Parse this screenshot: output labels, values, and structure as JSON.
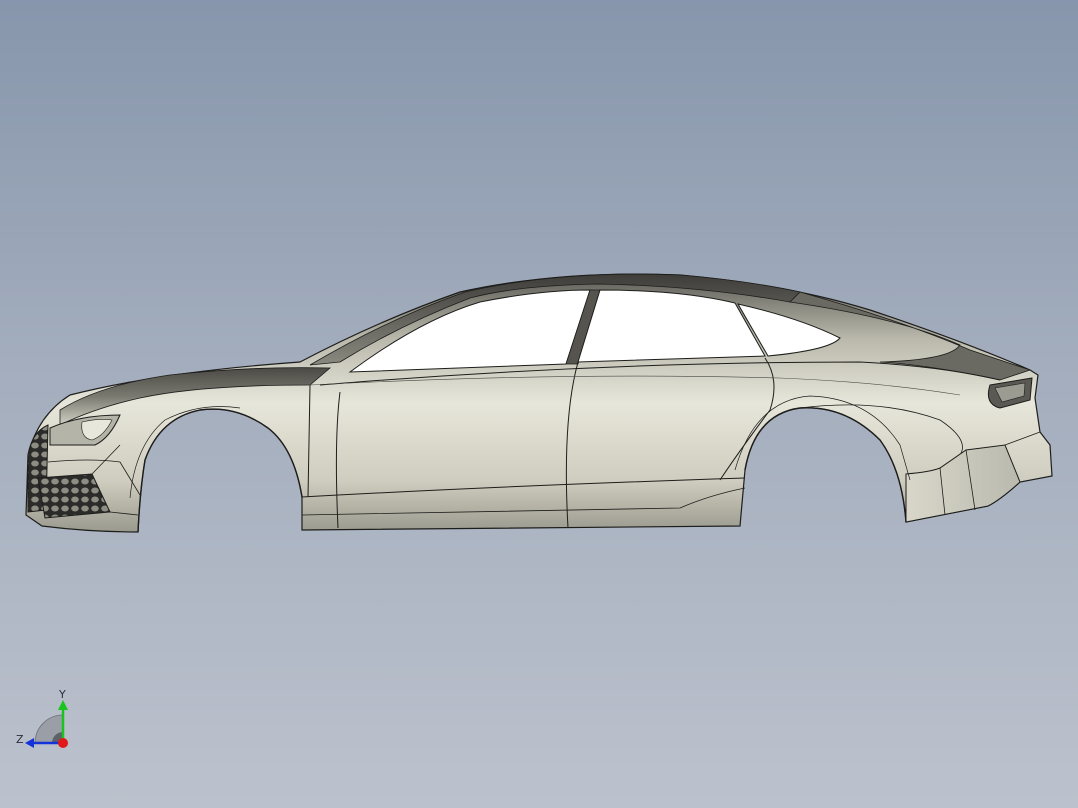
{
  "viewport": {
    "background_top": "#8796ac",
    "background_bottom": "#bcc2cd"
  },
  "model": {
    "body_color": "#d7d6c8",
    "shade_color": "#8e8d82",
    "glass_color": "#ffffff",
    "edge_color": "#1d1d1b"
  },
  "triad": {
    "y_label": "Y",
    "z_label": "Z",
    "y_color": "#19c41f",
    "z_color": "#1533d8",
    "x_color": "#e01818"
  }
}
